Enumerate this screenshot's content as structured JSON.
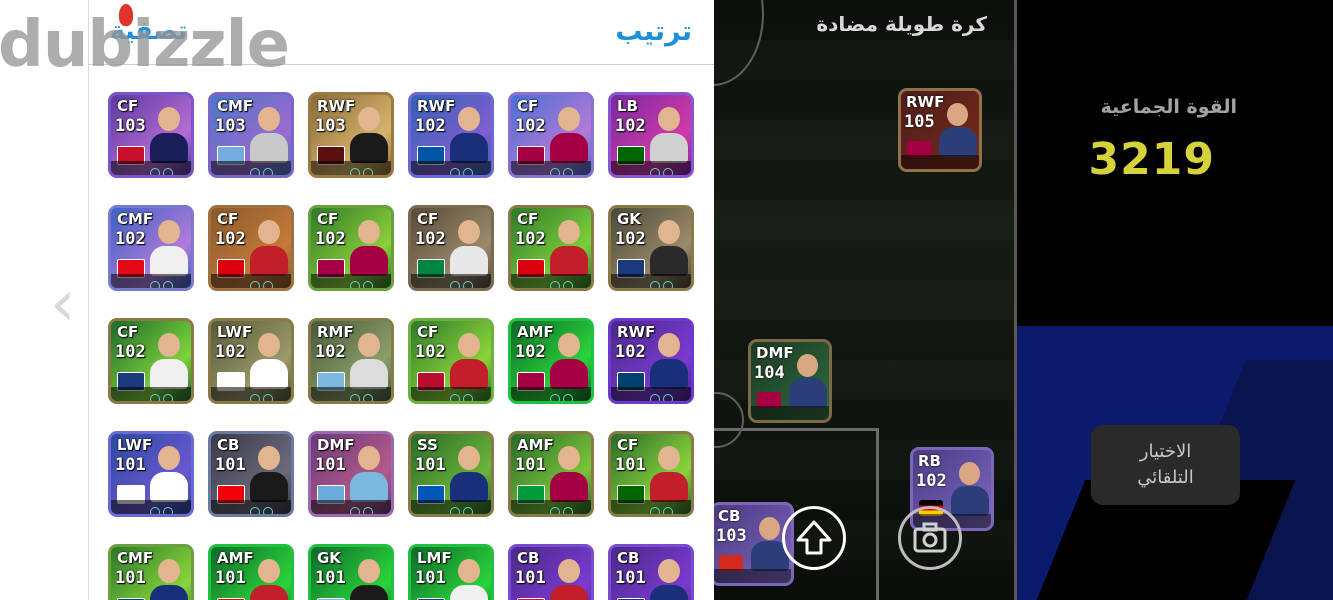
{
  "watermark": {
    "text": "dubizzle"
  },
  "nav": {
    "prev_glyph": "‹"
  },
  "panel": {
    "sort_label": "ترتيب",
    "filter_label": "تصفية"
  },
  "players": [
    {
      "pos": "CF",
      "rating": "103"
    },
    {
      "pos": "CMF",
      "rating": "103"
    },
    {
      "pos": "RWF",
      "rating": "103"
    },
    {
      "pos": "RWF",
      "rating": "102"
    },
    {
      "pos": "CF",
      "rating": "102"
    },
    {
      "pos": "LB",
      "rating": "102"
    },
    {
      "pos": "CMF",
      "rating": "102"
    },
    {
      "pos": "CF",
      "rating": "102"
    },
    {
      "pos": "CF",
      "rating": "102"
    },
    {
      "pos": "CF",
      "rating": "102"
    },
    {
      "pos": "CF",
      "rating": "102"
    },
    {
      "pos": "GK",
      "rating": "102"
    },
    {
      "pos": "CF",
      "rating": "102"
    },
    {
      "pos": "LWF",
      "rating": "102"
    },
    {
      "pos": "RMF",
      "rating": "102"
    },
    {
      "pos": "CF",
      "rating": "102"
    },
    {
      "pos": "AMF",
      "rating": "102"
    },
    {
      "pos": "RWF",
      "rating": "102"
    },
    {
      "pos": "LWF",
      "rating": "101"
    },
    {
      "pos": "CB",
      "rating": "101"
    },
    {
      "pos": "DMF",
      "rating": "101"
    },
    {
      "pos": "SS",
      "rating": "101"
    },
    {
      "pos": "AMF",
      "rating": "101"
    },
    {
      "pos": "CF",
      "rating": "101"
    },
    {
      "pos": "CMF",
      "rating": "101"
    },
    {
      "pos": "AMF",
      "rating": "101"
    },
    {
      "pos": "GK",
      "rating": "101"
    },
    {
      "pos": "LMF",
      "rating": "101"
    },
    {
      "pos": "CB",
      "rating": "101"
    },
    {
      "pos": "CB",
      "rating": "101"
    }
  ],
  "field": {
    "formation_label": "كرة طويلة مضادة",
    "cards": [
      {
        "pos": "RWF",
        "rating": "105"
      },
      {
        "pos": "DMF",
        "rating": "104"
      },
      {
        "pos": "RB",
        "rating": "102"
      },
      {
        "pos": "CB",
        "rating": "103"
      }
    ],
    "upload_icon": "upload-arrow-icon",
    "camera_icon": "camera-icon"
  },
  "team": {
    "strength_label": "القوة الجماعية",
    "strength_value": "3219"
  },
  "auto_select": {
    "label": "الاختيار التلقائي"
  },
  "colors": {
    "accent_link": "#1f8fd8",
    "team_value": "#d6d23a",
    "field_bg": "#0f140e"
  }
}
